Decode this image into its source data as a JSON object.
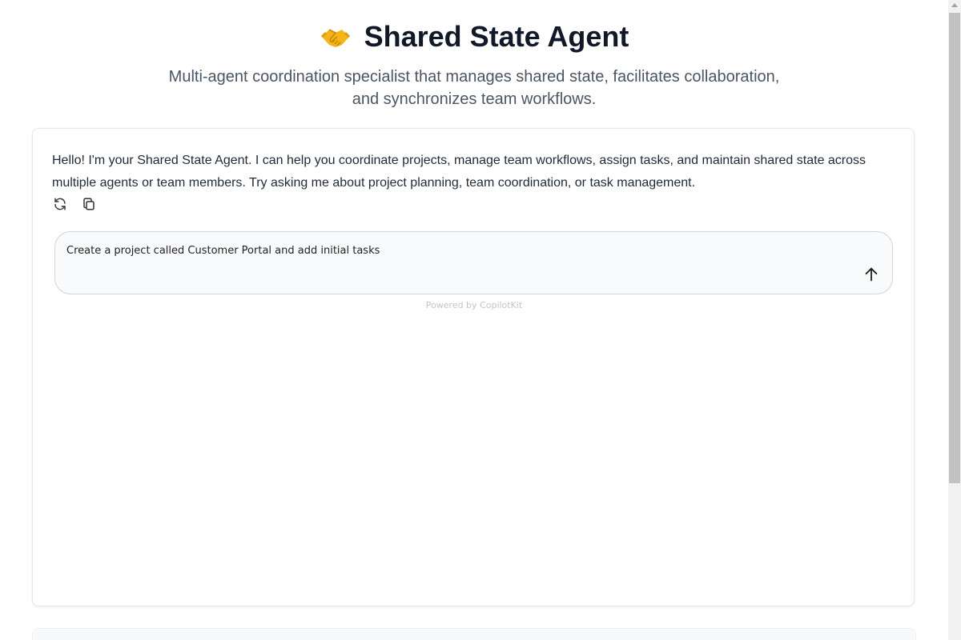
{
  "header": {
    "icon": "handshake-icon",
    "title": "Shared State Agent",
    "subtitle": "Multi-agent coordination specialist that manages shared state, facilitates collaboration, and synchronizes team workflows."
  },
  "chat": {
    "assistant_message": "Hello! I'm your Shared State Agent. I can help you coordinate projects, manage team workflows, assign tasks, and maintain shared state across multiple agents or team members. Try asking me about project planning, team coordination, or task management.",
    "controls": {
      "regenerate_icon": "refresh-icon",
      "copy_icon": "copy-icon"
    },
    "input": {
      "value": "Create a project called Customer Portal and add initial tasks",
      "send_icon": "arrow-up-icon"
    },
    "powered_by": "Powered by CopilotKit"
  },
  "colors": {
    "title": "#111827",
    "subtitle": "#4b5563",
    "emoji": "#f5b417"
  }
}
